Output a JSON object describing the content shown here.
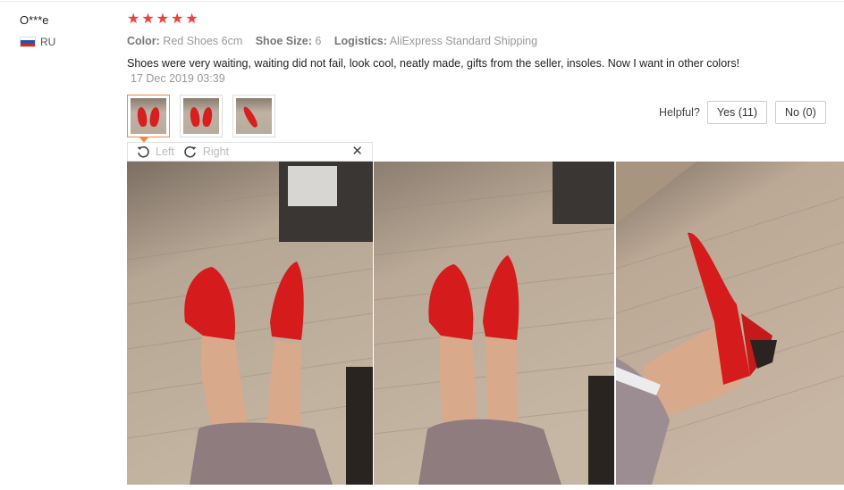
{
  "reviewer": {
    "name": "O***e",
    "country_code": "RU"
  },
  "rating": {
    "stars": 5,
    "star_color": "#f0403b"
  },
  "attributes": [
    {
      "key": "Color:",
      "value": "Red Shoes 6cm"
    },
    {
      "key": "Shoe Size:",
      "value": "6"
    },
    {
      "key": "Logistics:",
      "value": "AliExpress Standard Shipping"
    }
  ],
  "review": {
    "text": "Shoes were very waiting, waiting did not fail, look cool, neatly made, gifts from the seller, insoles. Now I want in other colors!",
    "date": "17 Dec 2019 03:39"
  },
  "thumbnails": [
    "photo-1",
    "photo-2",
    "photo-3"
  ],
  "helpful": {
    "label": "Helpful?",
    "yes_label": "Yes (11)",
    "no_label": "No (0)"
  },
  "viewer": {
    "rotate_left_label": "Left",
    "rotate_right_label": "Right",
    "close_glyph": "✕",
    "rotate_left_icon": "rotate-left-icon",
    "rotate_right_icon": "rotate-right-icon"
  },
  "colors": {
    "accent_orange": "#f08a43",
    "shoe_red": "#d61f1f"
  }
}
